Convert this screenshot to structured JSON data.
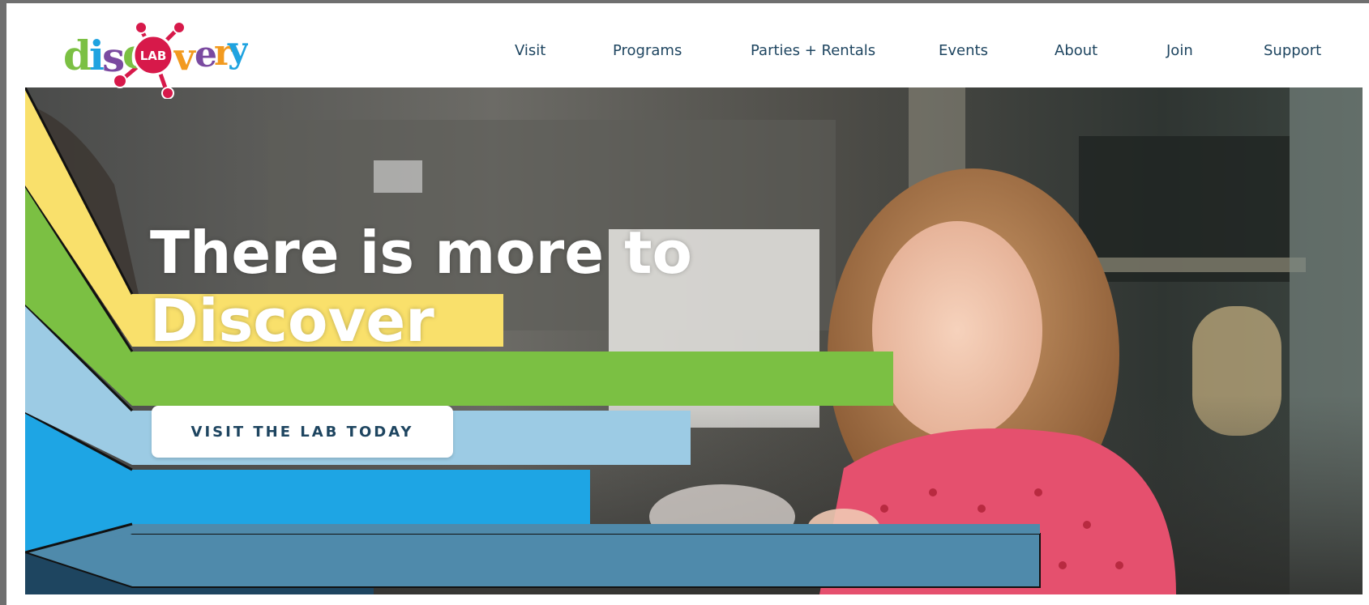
{
  "logo": {
    "letters": [
      "d",
      "i",
      "s",
      "c",
      "o",
      "v",
      "e",
      "r",
      "y"
    ],
    "badge_text": "LAB",
    "colors": {
      "green": "#7bc043",
      "blue": "#1fa3e0",
      "red": "#d7194a",
      "orange": "#f29a1f",
      "purple": "#7a4aa0",
      "yellow": "#f5c51a"
    }
  },
  "nav": {
    "items": [
      {
        "label": "Visit"
      },
      {
        "label": "Programs"
      },
      {
        "label": "Parties + Rentals"
      },
      {
        "label": "Events"
      },
      {
        "label": "About"
      },
      {
        "label": "Join"
      },
      {
        "label": "Support"
      }
    ]
  },
  "hero": {
    "headline_line1": "There is more to",
    "headline_line2": "Discover",
    "cta_label": "VISIT THE LAB TODAY",
    "stripe_colors": {
      "yellow": "#f9e06b",
      "green": "#7bc043",
      "light_blue": "#9ccbe4",
      "bright_blue": "#1ea5e4",
      "steel_blue": "#4f8aab",
      "navy": "#1e4560"
    }
  },
  "colors": {
    "nav_text": "#1e4560",
    "page_bg": "#ffffff"
  }
}
